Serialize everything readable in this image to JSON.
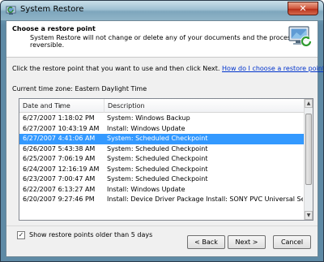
{
  "window": {
    "title": "System Restore",
    "close_label": "✕"
  },
  "header": {
    "title": "Choose a restore point",
    "description": "System Restore will not change or delete any of your documents and the process is reversible."
  },
  "instruction": {
    "text": "Click the restore point that you want to use and then click Next.",
    "help_link": "How do I choose a restore point?"
  },
  "timezone": "Current time zone: Eastern Daylight Time",
  "list": {
    "columns": [
      "Date and Time",
      "Description"
    ],
    "rows": [
      {
        "date": "6/27/2007 1:18:02 PM",
        "description": "System: Windows Backup"
      },
      {
        "date": "6/27/2007 10:43:19 AM",
        "description": "Install: Windows Update"
      },
      {
        "date": "6/27/2007 4:41:06 AM",
        "description": "System: Scheduled Checkpoint"
      },
      {
        "date": "6/26/2007 5:43:38 AM",
        "description": "System: Scheduled Checkpoint"
      },
      {
        "date": "6/25/2007 7:06:19 AM",
        "description": "System: Scheduled Checkpoint"
      },
      {
        "date": "6/24/2007 12:16:19 AM",
        "description": "System: Scheduled Checkpoint"
      },
      {
        "date": "6/23/2007 7:00:47 AM",
        "description": "System: Scheduled Checkpoint"
      },
      {
        "date": "6/22/2007 6:13:27 AM",
        "description": "Install: Windows Update"
      },
      {
        "date": "6/20/2007 9:27:46 PM",
        "description": "Install: Device Driver Package Install: SONY PVC Universal Serial Bu..."
      }
    ],
    "selected_index": 2
  },
  "show_older": {
    "checked": true,
    "label": "Show restore points older than 5 days"
  },
  "buttons": {
    "back": "< Back",
    "next": "Next >",
    "cancel": "Cancel"
  },
  "colors": {
    "selection": "#3399ff",
    "link": "#0033cc",
    "close_button": "#c8432a"
  }
}
